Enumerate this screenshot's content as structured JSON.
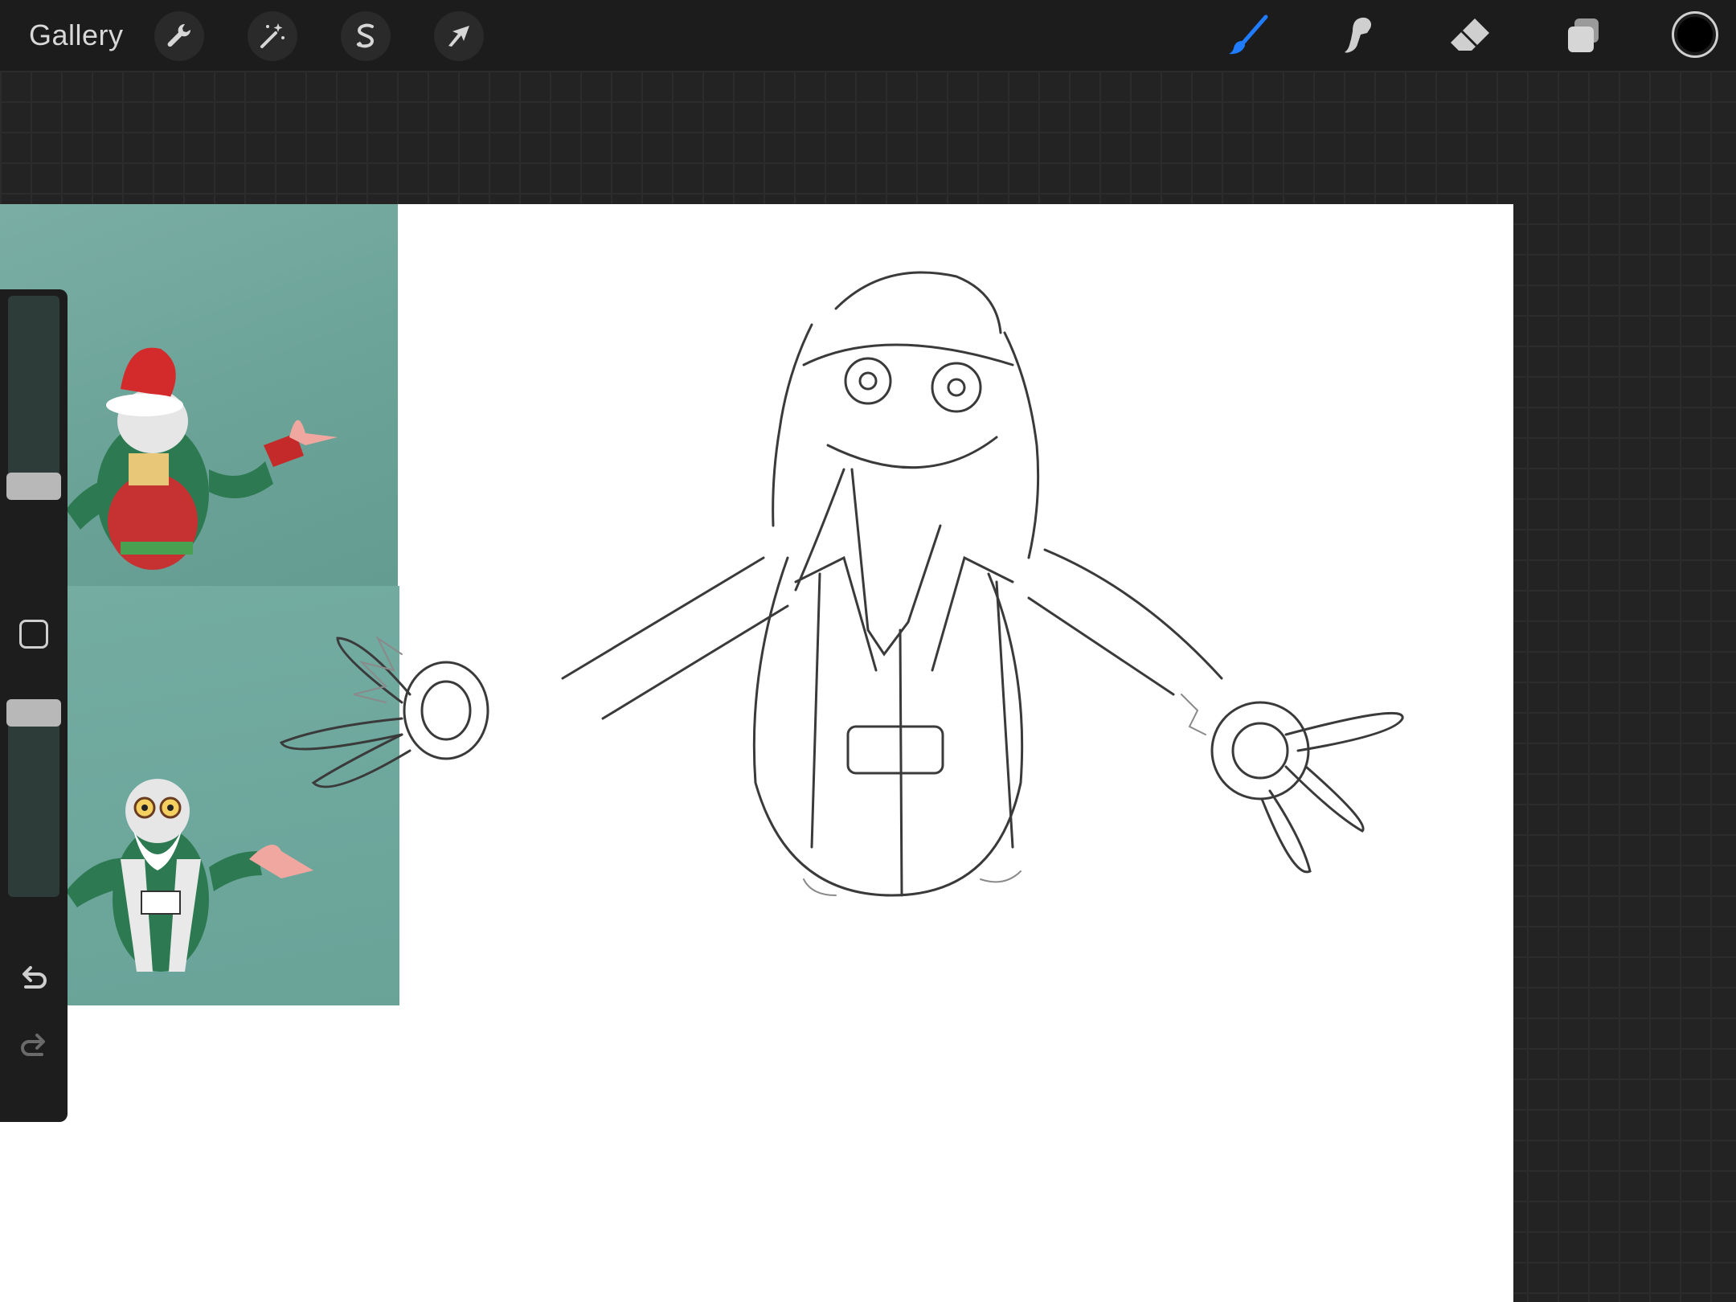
{
  "app": {
    "gallery_label": "Gallery"
  },
  "toolbar": {
    "left_tools": [
      "wrench-icon",
      "magic-wand-icon",
      "selection-icon",
      "transform-arrow-icon"
    ],
    "right_tools": [
      "brush-icon",
      "smudge-icon",
      "eraser-icon",
      "layers-icon"
    ],
    "active_tool": "brush",
    "active_color": "#000000",
    "accent_color": "#1f7cff"
  },
  "sidebar": {
    "brush_size_level": 0.47,
    "opacity_level": 0.0,
    "modify_button": "square-icon",
    "undo": "undo-icon",
    "redo": "redo-icon"
  },
  "canvas": {
    "background": "#ffffff",
    "reference_color": "#6ea69b"
  }
}
